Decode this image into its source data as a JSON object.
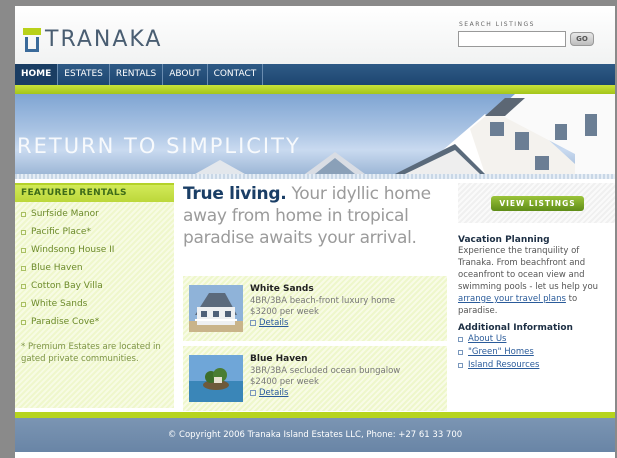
{
  "header": {
    "logo_text": "TRANAKA",
    "search_label": "SEARCH LISTINGS",
    "search_value": "",
    "go_label": "GO"
  },
  "nav": {
    "items": [
      "HOME",
      "ESTATES",
      "RENTALS",
      "ABOUT",
      "CONTACT"
    ],
    "active": "HOME"
  },
  "banner": {
    "tagline": "RETURN TO SIMPLICITY"
  },
  "sidebar": {
    "heading": "FEATURED RENTALS",
    "items": [
      "Surfside Manor",
      "Pacific Place*",
      "Windsong House II",
      "Blue Haven",
      "Cotton Bay Villa",
      "White Sands",
      "Paradise Cove*"
    ],
    "note": "* Premium Estates are located in gated private communities."
  },
  "main": {
    "headline_strong": "True living.",
    "headline_rest": " Your idyllic home away from home in tropical paradise awaits your arrival.",
    "listings": [
      {
        "title": "White Sands",
        "line1": "4BR/3BA beach-front luxury home",
        "line2": "$3200 per week",
        "link": "Details"
      },
      {
        "title": "Blue Haven",
        "line1": "3BR/3BA secluded ocean bungalow",
        "line2": "$2400 per week",
        "link": "Details"
      }
    ]
  },
  "right": {
    "view_button": "VIEW LISTINGS",
    "vacation_heading": "Vacation Planning",
    "vacation_text": "Experience the tranquility of Tranaka. From beachfront and oceanfront to ocean view and swimming pools - let us help you ",
    "vacation_link": "arrange your travel plans",
    "vacation_tail": " to paradise.",
    "info_heading": "Additional Information",
    "info_links": [
      "About Us",
      "\"Green\" Homes",
      "Island Resources"
    ]
  },
  "footer": {
    "text": "© Copyright 2006 Tranaka Island Estates LLC, Phone: +27 61 33 700"
  },
  "colors": {
    "nav_blue": "#1d4670",
    "lime": "#b6d41e",
    "headline_blue": "#1a3e66",
    "link_blue": "#2a5b9a"
  }
}
